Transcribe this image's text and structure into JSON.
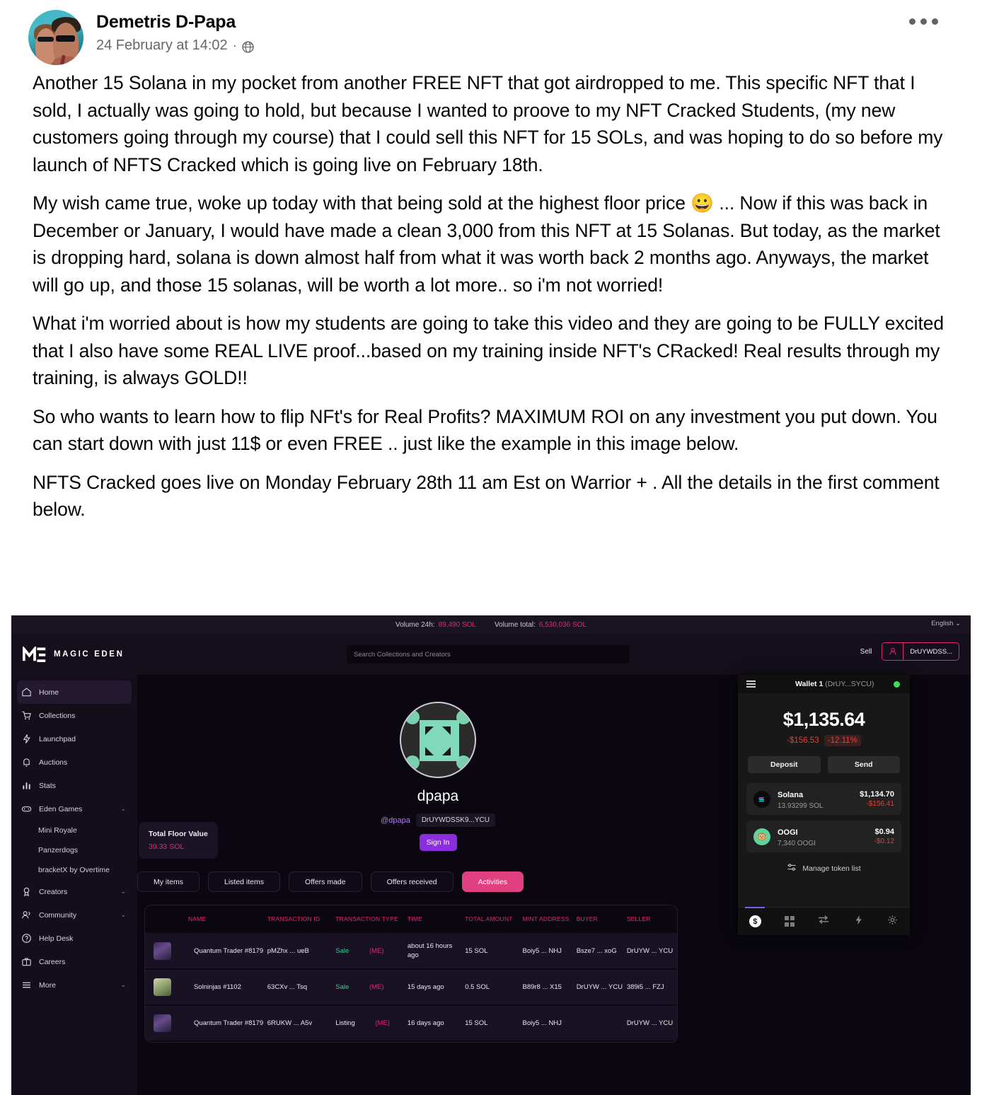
{
  "post": {
    "author": "Demetris D-Papa",
    "timestamp": "24 February at 14:02",
    "separator": "·",
    "privacy_icon": "globe-icon",
    "menu_icon": "ellipsis-icon",
    "paragraphs": [
      "Another 15 Solana in my pocket from another FREE NFT that got airdropped to me.  This specific NFT that I sold, I actually was going to hold, but because I wanted to proove to my NFT Cracked Students, (my new customers going through my course) that I could sell this NFT for 15 SOLs, and was hoping to do so before my launch of NFTS Cracked which is going live on February 18th.",
      "My wish came true, woke up today with that being sold at the highest floor price 😀 ... Now if this was back in December or January, I would have made a clean 3,000 from this NFT at 15 Solanas.   But today, as the market is dropping hard, solana is down almost half from what it was worth back 2 months ago.   Anyways, the market will go up, and those 15 solanas, will be worth a lot more.. so i'm not worried!",
      "What i'm worried about is how my students are going to take this video and they are going to be FULLY excited that I also have some REAL LIVE proof...based on my training inside NFT's CRacked!   Real results through my training, is always GOLD!!",
      "So who wants to learn how to flip NFt's for Real Profits?   MAXIMUM ROI on any investment you put down.  You can start down with just 11$ or even FREE .. just like the example in this image below.",
      "NFTS Cracked goes live on Monday February 28th 11 am Est on Warrior +  .  All the details in the first comment below."
    ]
  },
  "embed": {
    "topbar": {
      "volume_24h_label": "Volume 24h:",
      "volume_24h_value": "89,490 SOL",
      "volume_total_label": "Volume total:",
      "volume_total_value": "6,530,036 SOL",
      "language": "English"
    },
    "header": {
      "brand": "MAGIC EDEN",
      "search_placeholder": "Search Collections and Creators",
      "sell_label": "Sell",
      "wallet_address": "DrUYWDSS..."
    },
    "sidebar": {
      "items": [
        {
          "label": "Home",
          "icon": "home-icon",
          "active": true
        },
        {
          "label": "Collections",
          "icon": "cart-icon",
          "active": false
        },
        {
          "label": "Launchpad",
          "icon": "bolt-icon",
          "active": false
        },
        {
          "label": "Auctions",
          "icon": "bell-icon",
          "active": false
        },
        {
          "label": "Stats",
          "icon": "bar-chart-icon",
          "active": false
        },
        {
          "label": "Eden Games",
          "icon": "gamepad-icon",
          "active": false,
          "chevron": true
        }
      ],
      "sub_items": [
        "Mini Royale",
        "Panzerdogs",
        "bracketX by Overtime"
      ],
      "items_after": [
        {
          "label": "Creators",
          "icon": "award-icon",
          "chevron": true
        },
        {
          "label": "Community",
          "icon": "people-icon",
          "chevron": true
        },
        {
          "label": "Help Desk",
          "icon": "question-circle-icon",
          "chevron": false
        },
        {
          "label": "Careers",
          "icon": "briefcase-icon",
          "chevron": false
        },
        {
          "label": "More",
          "icon": "menu-icon",
          "chevron": true
        }
      ]
    },
    "profile": {
      "name": "dpapa",
      "handle": "@dpapa",
      "address": "DrUYWDSSK9...YCU",
      "sign_in_label": "Sign In",
      "floor_title": "Total Floor Value",
      "floor_value": "39.33 SOL"
    },
    "tabs": [
      {
        "label": "My items",
        "active": false
      },
      {
        "label": "Listed items",
        "active": false
      },
      {
        "label": "Offers made",
        "active": false
      },
      {
        "label": "Offers received",
        "active": false
      },
      {
        "label": "Activities",
        "active": true
      }
    ],
    "table": {
      "headers": [
        "NAME",
        "TRANSACTION ID",
        "TRANSACTION TYPE",
        "TIME",
        "TOTAL AMOUNT",
        "MINT ADDRESS",
        "BUYER",
        "SELLER"
      ],
      "rows": [
        {
          "thumb": "qt",
          "name": "Quantum Trader #8179",
          "transaction_id": "pMZhx ... ueB",
          "transaction_type": "Sale",
          "marketplace": "(ME)",
          "time": "about 16 hours ago",
          "total_amount": "15 SOL",
          "mint_address": "Boiy5 ... NHJ",
          "buyer": "Bsze7 ... xoG",
          "seller": "DrUYW ... YCU"
        },
        {
          "thumb": "sn",
          "name": "Solninjas #1102",
          "transaction_id": "63CXv ... Tsq",
          "transaction_type": "Sale",
          "marketplace": "(ME)",
          "time": "15 days ago",
          "total_amount": "0.5 SOL",
          "mint_address": "B89r8 ... X15",
          "buyer": "DrUYW ... YCU",
          "seller": "389i5 ... FZJ"
        },
        {
          "thumb": "qt",
          "name": "Quantum Trader #8179",
          "transaction_id": "6RUKW ... A5v",
          "transaction_type": "Listing",
          "marketplace": "(ME)",
          "time": "16 days ago",
          "total_amount": "15 SOL",
          "mint_address": "Boiy5 ... NHJ",
          "buyer": "",
          "seller": "DrUYW ... YCU"
        }
      ]
    },
    "wallet": {
      "title": "Wallet 1",
      "title_address": "(DrUY...SYCU)",
      "balance": "$1,135.64",
      "delta_value": "-$156.53",
      "delta_pct": "-12.11%",
      "deposit_label": "Deposit",
      "send_label": "Send",
      "tokens": [
        {
          "name": "Solana",
          "amount": "13.93299 SOL",
          "usd": "$1,134.70",
          "change": "-$156.41",
          "icon": "solana-icon"
        },
        {
          "name": "OOGI",
          "amount": "7,340 OOGI",
          "usd": "$0.94",
          "change": "-$0.12",
          "icon": "oogi-icon"
        }
      ],
      "manage_label": "Manage token list",
      "tabbar": [
        "coin-icon",
        "apps-icon",
        "swap-icon",
        "bolt-icon",
        "gear-icon"
      ]
    },
    "colors": {
      "accent_pink": "#e42575",
      "tab_active": "#e0407f",
      "sign_in_purple": "#8b2ee0",
      "sale_green": "#3ecf8e",
      "negative_red": "#e3413a",
      "status_green": "#3ddc5b"
    }
  }
}
